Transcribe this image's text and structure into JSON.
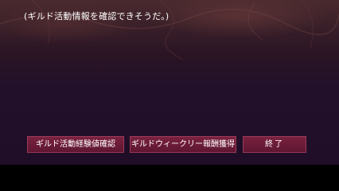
{
  "dialog": {
    "message": "(ギルド活動情報を確認できそうだ。)"
  },
  "menu": {
    "options": [
      {
        "label": "ギルド活動経験値確認"
      },
      {
        "label": "ギルドウィークリー報酬獲得"
      },
      {
        "label": "終了"
      }
    ]
  },
  "colors": {
    "button_fill": "#6a1a36",
    "button_border": "#9a3a58",
    "scene_top": "#4a2a2e",
    "scene_bottom": "#200e28",
    "text": "#ffffff"
  }
}
